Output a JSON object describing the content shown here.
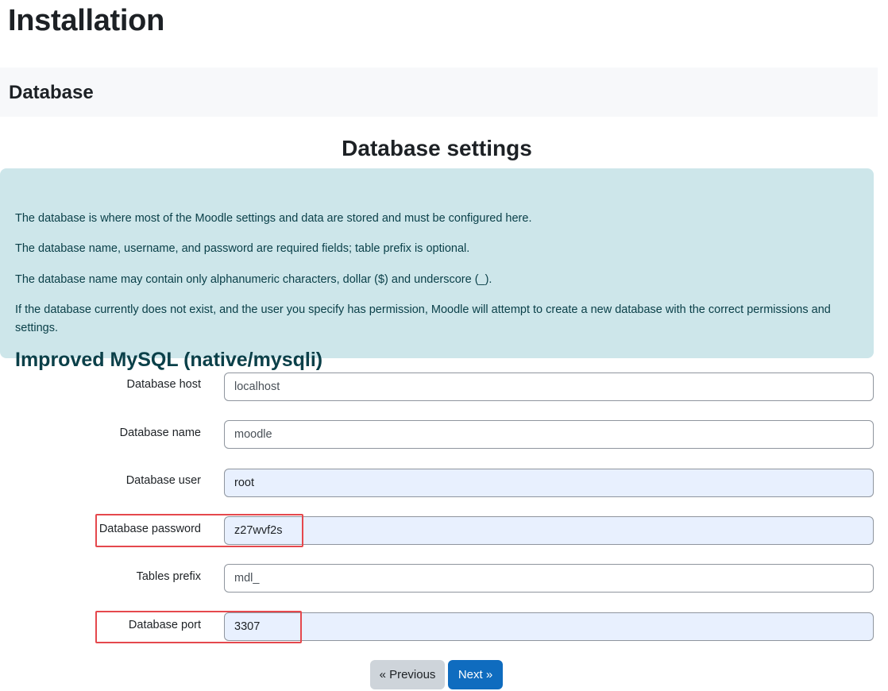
{
  "page": {
    "title": "Installation",
    "section": "Database",
    "settings_title": "Database settings"
  },
  "info": {
    "heading": "Improved MySQL (native/mysqli)",
    "paragraphs": [
      "The database is where most of the Moodle settings and data are stored and must be configured here.",
      "The database name, username, and password are required fields; table prefix is optional.",
      "The database name may contain only alphanumeric characters, dollar ($) and underscore (_).",
      "If the database currently does not exist, and the user you specify has permission, Moodle will attempt to create a new database with the correct permissions and settings."
    ]
  },
  "form": {
    "fields": [
      {
        "label": "Database host",
        "value": "localhost",
        "autofilled": false
      },
      {
        "label": "Database name",
        "value": "moodle",
        "autofilled": false
      },
      {
        "label": "Database user",
        "value": "root",
        "autofilled": true
      },
      {
        "label": "Database password",
        "value": "z27wvf2s",
        "autofilled": true,
        "highlighted": true
      },
      {
        "label": "Tables prefix",
        "value": "mdl_",
        "autofilled": false
      },
      {
        "label": "Database port",
        "value": "3307",
        "autofilled": true,
        "highlighted": true
      }
    ]
  },
  "buttons": {
    "previous": "« Previous",
    "next": "Next »"
  },
  "colors": {
    "info_background": "#cde6ea",
    "info_text": "#0b4049",
    "autofill_background": "#e8f0fe",
    "highlight_border": "#e5484d",
    "primary_button": "#0f6cbf",
    "secondary_button": "#ced4da"
  }
}
